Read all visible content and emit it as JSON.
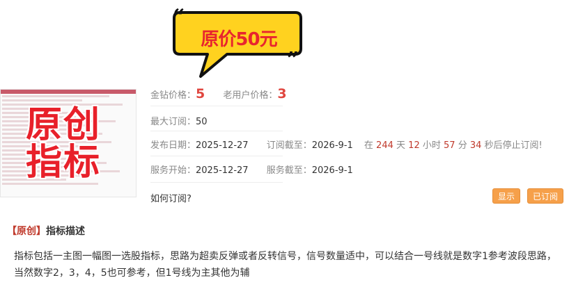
{
  "badge": {
    "text": "原价50元"
  },
  "thumbnail": {
    "overlay_text": "原创\n指标"
  },
  "pricing": {
    "gold_label": "金钻价格：",
    "gold_value": "5",
    "old_user_label": "老用户价格：",
    "old_user_value": "3"
  },
  "max_subscription": {
    "label": "最大订阅：",
    "value": "50"
  },
  "publish": {
    "date_label": "发布日期：",
    "date_value": "2025-12-27",
    "deadline_label": "订阅截至：",
    "deadline_value": "2026-9-1",
    "countdown_prefix": "在",
    "days": "244",
    "days_unit": "天",
    "hours": "12",
    "hours_unit": "小时",
    "minutes": "57",
    "minutes_unit": "分",
    "seconds": "34",
    "countdown_suffix": "秒后停止订阅!"
  },
  "service": {
    "start_label": "服务开始：",
    "start_value": "2025-12-27",
    "end_label": "服务截至：",
    "end_value": "2026-9-1"
  },
  "how_to": {
    "label": "如何订阅?"
  },
  "buttons": {
    "show": "显示",
    "subscribed": "已订阅"
  },
  "description": {
    "tag": "【原创】",
    "title": "指标描述",
    "body": "指标包括一主图一幅图一选股指标，思路为超卖反弹或者反转信号，信号数量适中，可以结合一号线就是数字1参考波段思路，当然数字2，3，4，5也可参考，但1号线为主其他为辅"
  },
  "colors": {
    "accent_red": "#e0463f",
    "button_orange": "#f6a04a",
    "badge_yellow": "#ffd21f"
  }
}
